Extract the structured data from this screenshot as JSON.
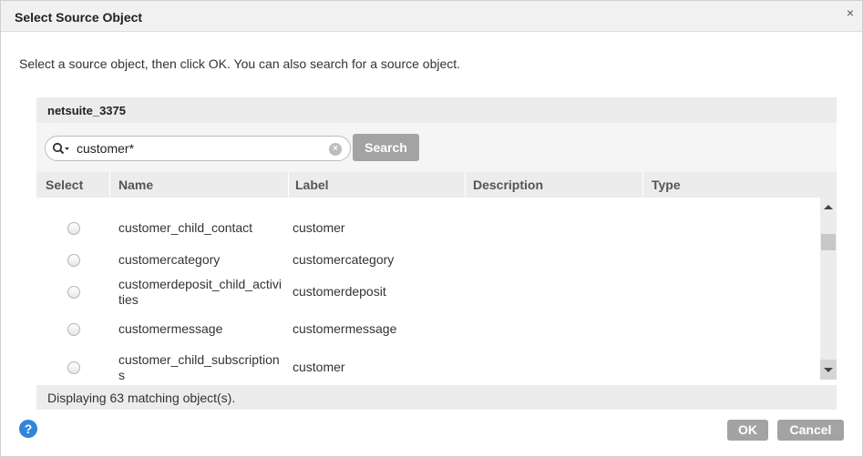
{
  "dialog": {
    "title": "Select Source Object",
    "close_glyph": "×",
    "instructions": "Select a source object, then click OK. You can also search for a source object."
  },
  "connection": {
    "name": "netsuite_3375"
  },
  "search": {
    "value": "customer*",
    "button_label": "Search",
    "icon": "search-dropdown-icon",
    "clear_icon": "clear-icon"
  },
  "table": {
    "columns": [
      "Select",
      "Name",
      "Label",
      "Description",
      "Type"
    ],
    "rows": [
      {
        "name": "customer_child_contact",
        "label": "customer",
        "description": "",
        "type": ""
      },
      {
        "name": "customercategory",
        "label": "customercategory",
        "description": "",
        "type": ""
      },
      {
        "name": "customerdeposit_child_activities",
        "label": "customerdeposit",
        "description": "",
        "type": ""
      },
      {
        "name": "customermessage",
        "label": "customermessage",
        "description": "",
        "type": ""
      },
      {
        "name": "customer_child_subscriptions",
        "label": "customer",
        "description": "",
        "type": ""
      }
    ]
  },
  "status": {
    "text": "Displaying 63 matching object(s)."
  },
  "footer": {
    "help_glyph": "?",
    "ok_label": "OK",
    "cancel_label": "Cancel"
  },
  "colors": {
    "button_gray": "#a3a3a3",
    "help_blue": "#2f86d6",
    "header_gray": "#ececec"
  }
}
